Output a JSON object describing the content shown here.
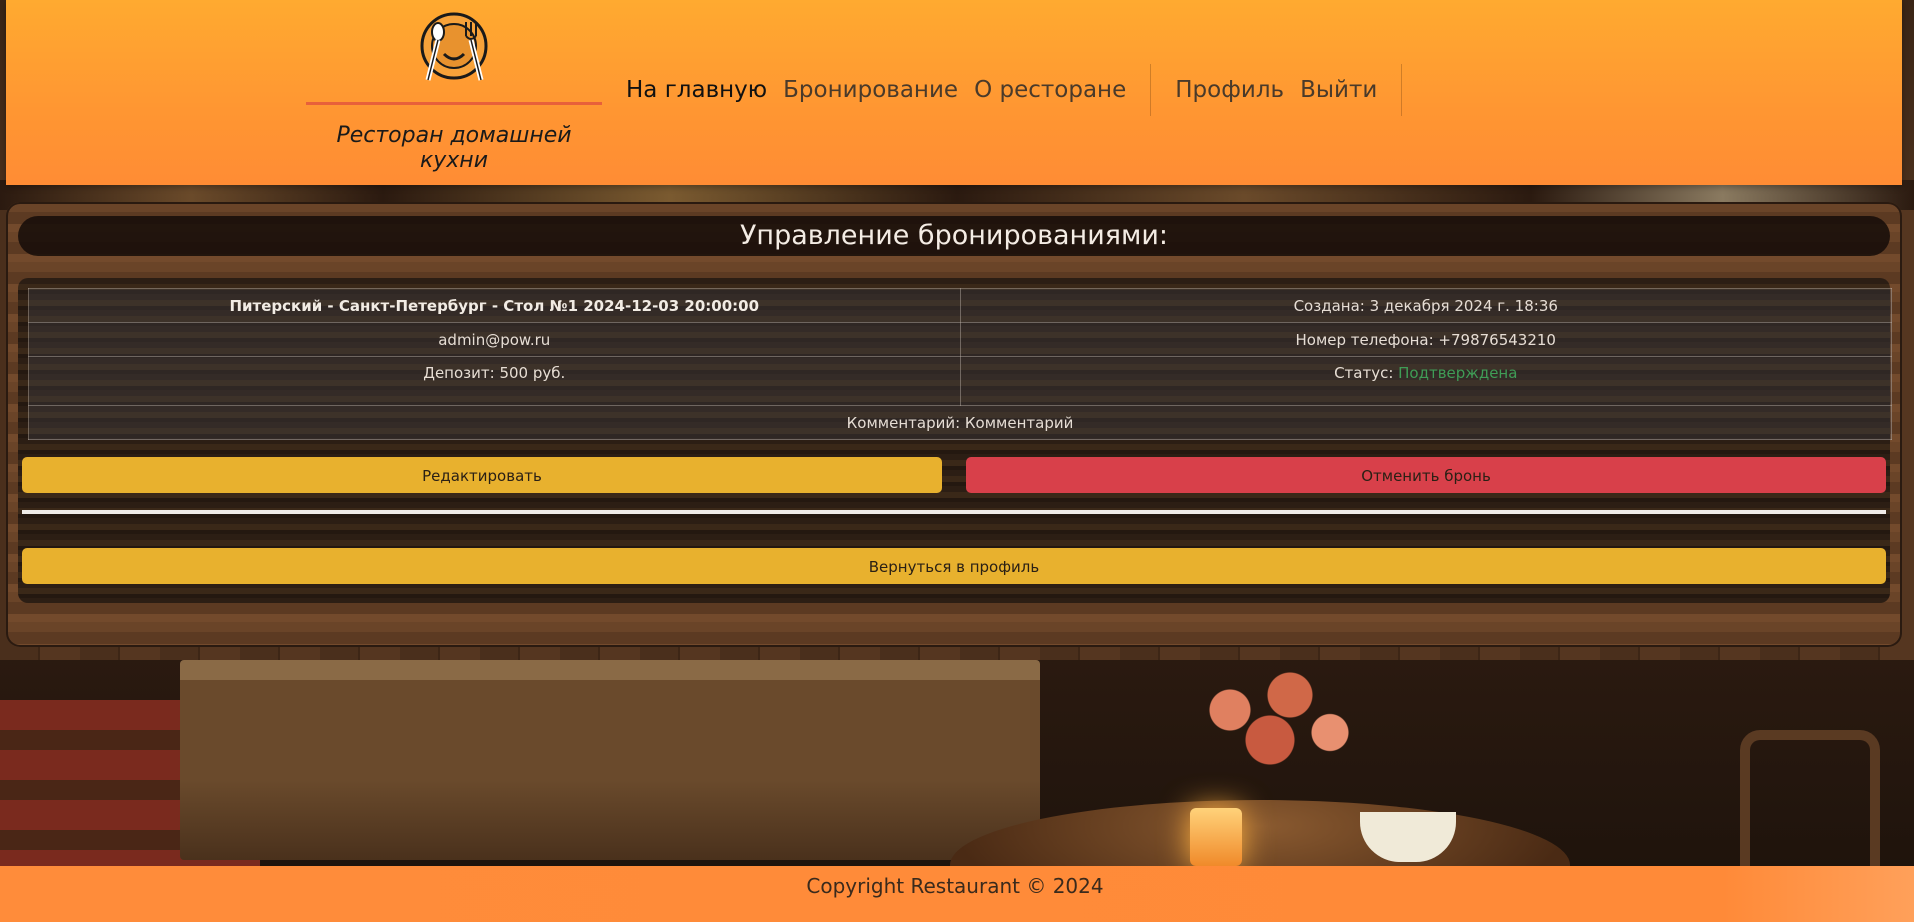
{
  "header": {
    "slogan": "Ресторан домашней кухни",
    "nav": {
      "home": "На главную",
      "booking": "Бронирование",
      "about": "О ресторане",
      "profile": "Профиль",
      "logout": "Выйти"
    }
  },
  "main": {
    "title": "Управление бронированиями:",
    "reservation": {
      "summary": "Питерский - Санкт-Петербург - Стол №1 2024-12-03 20:00:00",
      "created": "Создана: 3 декабря 2024 г. 18:36",
      "email": "admin@pow.ru",
      "phone": "Номер телефона: +79876543210",
      "deposit": "Депозит: 500 руб.",
      "status_label": "Статус: ",
      "status_value": "Подтверждена",
      "comment": "Комментарий: Комментарий"
    },
    "buttons": {
      "edit": "Редактировать",
      "cancel": "Отменить бронь",
      "back": "Вернуться в профиль"
    }
  },
  "footer": {
    "copyright": "Copyright Restaurant © 2024"
  },
  "colors": {
    "header": "#ff9632",
    "edit_button": "#e8b12e",
    "cancel_button": "#d8404a",
    "status_confirmed": "#3f9c56",
    "footer": "#ff8c3a"
  },
  "icons": {
    "logo": "plate-spoon-fork-icon"
  }
}
